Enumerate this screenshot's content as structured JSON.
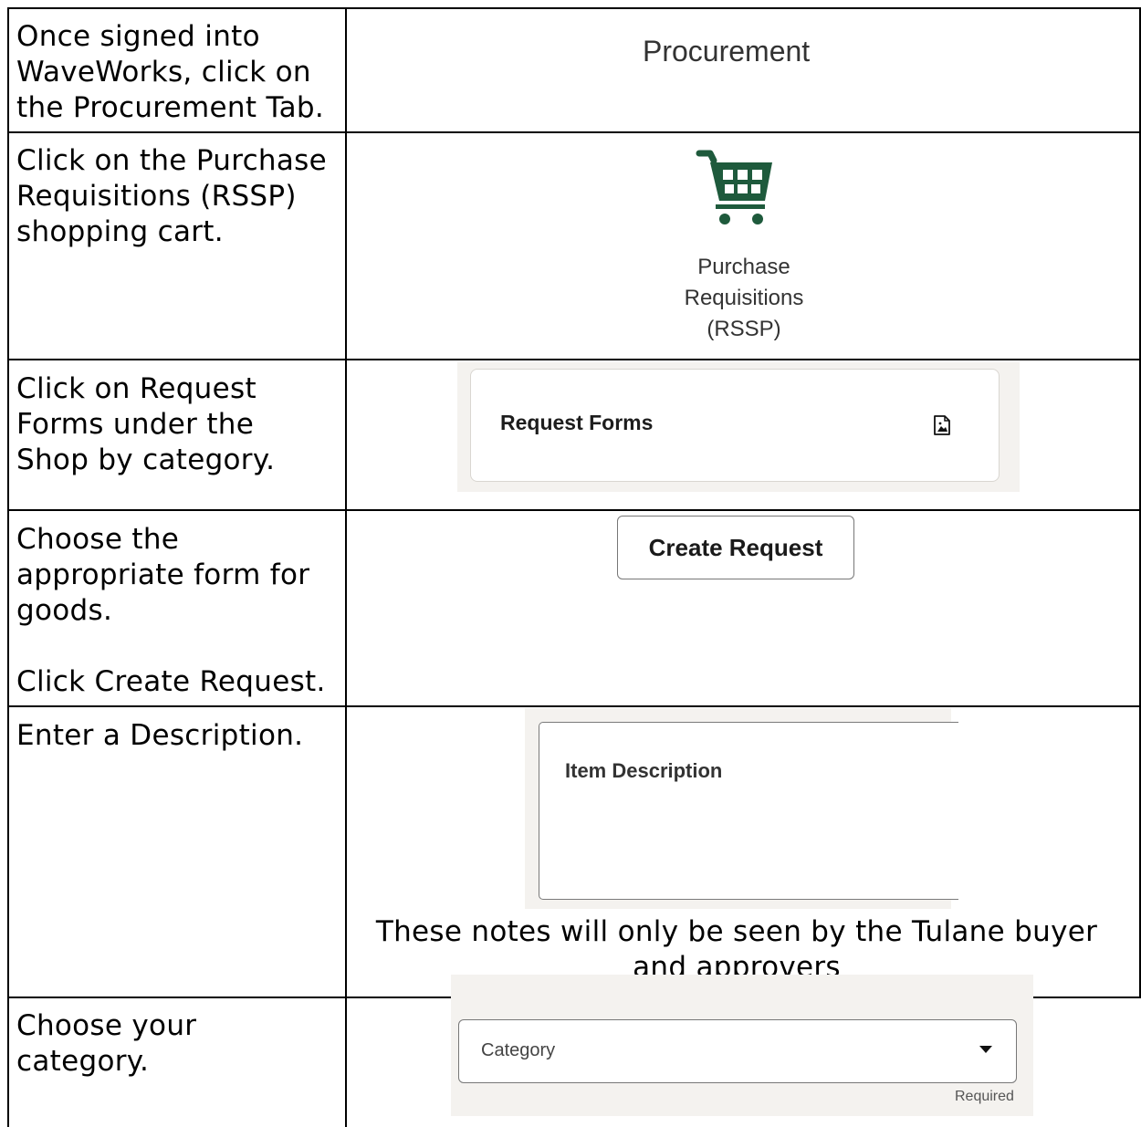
{
  "rows": [
    {
      "instruction": "Once signed into\nWaveWorks, click on\nthe Procurement Tab."
    },
    {
      "instruction": "Click on the Purchase\nRequisitions (RSSP)\nshopping cart."
    },
    {
      "instruction": "Click on Request\nForms under the\nShop by category."
    },
    {
      "instruction": "Choose the\nappropriate form for\ngoods.\n\nClick Create Request."
    },
    {
      "instruction": "Enter a Description."
    },
    {
      "instruction": "Choose your\ncategory."
    }
  ],
  "procurement_tab": {
    "label": "Procurement"
  },
  "purchase_req": {
    "label": "Purchase\nRequisitions\n(RSSP)",
    "icon": "shopping-cart-icon",
    "icon_color": "#1e5a3c"
  },
  "request_forms": {
    "label": "Request Forms",
    "icon": "document-image-icon"
  },
  "create_request": {
    "label": "Create Request"
  },
  "item_description": {
    "label": "Item Description",
    "note": "These notes will only be seen by the Tulane buyer\nand approvers"
  },
  "category": {
    "label": "Category",
    "required": "Required",
    "icon": "caret-down-icon"
  }
}
